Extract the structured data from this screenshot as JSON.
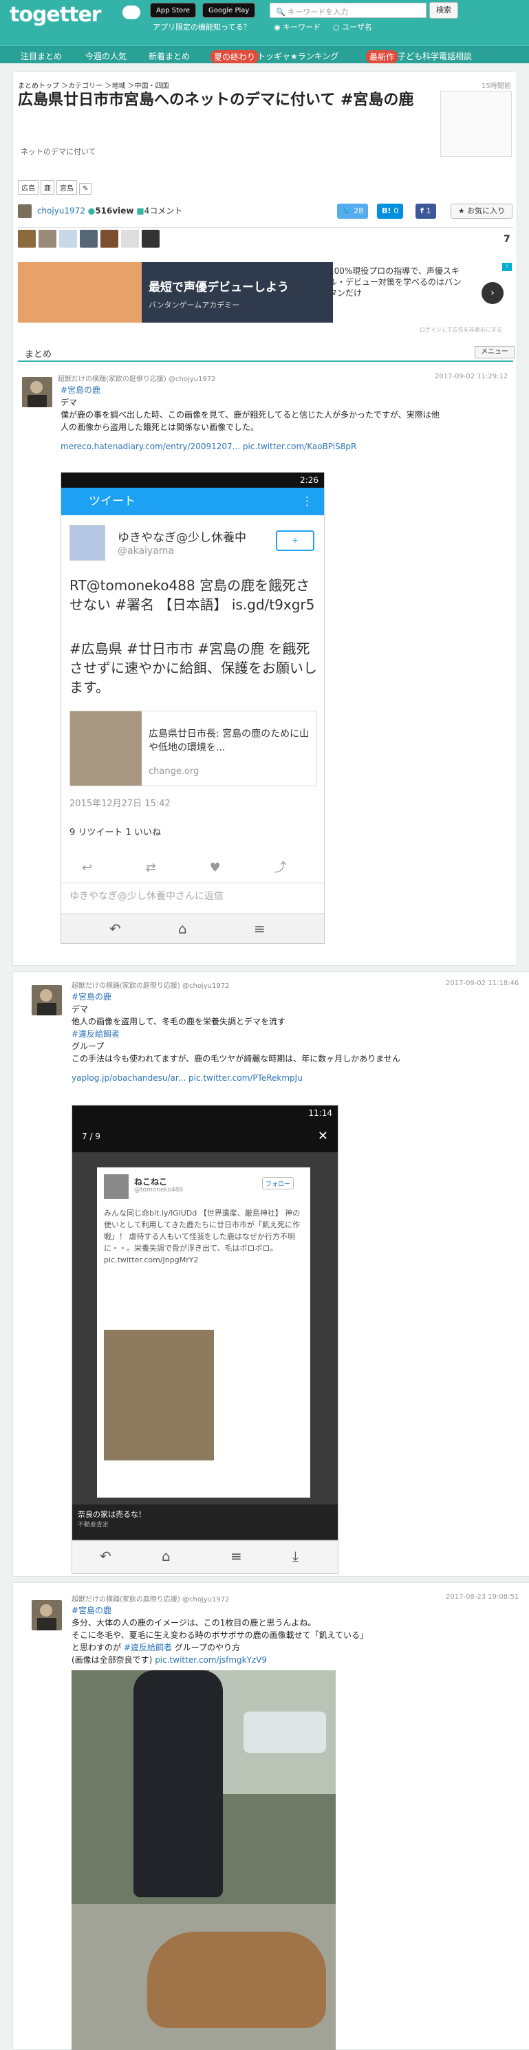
{
  "header": {
    "logo": "togetter",
    "appstore": "App Store",
    "googleplay": "Google Play",
    "tagline": "アプリ限定の機能知ってる？",
    "search_placeholder": "キーワードを入力",
    "search_button": "検索",
    "radio_keyword": "キーワード",
    "radio_user": "ユーザ名"
  },
  "nav": {
    "items": [
      "注目まとめ",
      "今週の人気",
      "新着まとめ"
    ],
    "badge1": "夏の終わり",
    "item4": "トッギャ★ランキング",
    "badge2": "最新作",
    "item5": "子ども科学電話相談"
  },
  "article": {
    "breadcrumb": "まとめトップ ＞カテゴリー ＞地域 ＞中国・四国",
    "timestamp": "15時間前",
    "title": "広島県廿日市市宮島へのネットのデマに付いて #宮島の鹿",
    "description": "ネットのデマに付いて",
    "tags": [
      "広島",
      "鹿",
      "宮島"
    ],
    "author": "chojyu1972",
    "views": "516view",
    "comments": "4コメント",
    "tweet_count": "28",
    "hatena_count": "0",
    "fb_count": "1",
    "fav_label": "お気に入り",
    "fav_count": "7"
  },
  "ad": {
    "headline": "最短で声優デビューしよう",
    "sub": "バンタンゲームアカデミー",
    "text": "100%現役プロの指導で、声優スキル・デビュー対策を学べるのはバンタンだけ",
    "note": "ログインして広告を非表示にする"
  },
  "section": {
    "matome": "まとめ",
    "menu": "メニュー"
  },
  "tweets": [
    {
      "name": "超獣だけの横踊(家飲の庭僚り応援) @chojyu1972",
      "date": "2017-09-02 11:29:12",
      "hashtag": "#宮島の鹿",
      "lines": [
        "デマ",
        "僕が鹿の事を調べ出した時、この画像を見て、鹿が餓死してると信じた人が多かったですが、実際は他",
        "人の画像から盗用した餓死とは関係ない画像でした。"
      ],
      "links": "mereco.hatenadiary.com/entry/20091207... pic.twitter.com/KaoBPiS8pR",
      "phone": {
        "time": "2:26",
        "bar_title": "ツイート",
        "user": "ゆきやなぎ@少し休養中",
        "handle": "@akaiyama",
        "text1": "RT@tomoneko488 宮島の鹿を餓死させない #署名 【日本語】 is.gd/t9xgr5",
        "text2": "#広島県 #廿日市市 #宮島の鹿 を餓死させずに速やかに給餌、保護をお願いします。",
        "card_title": "広島県廿日市長: 宮島の鹿のために山や低地の環境を...",
        "card_site": "change.org",
        "date": "2015年12月27日 15:42",
        "retweets": "9 リツイート  1 いいね",
        "reply": "ゆきやなぎ@少し休養中さんに返信"
      }
    },
    {
      "name": "超獣だけの横踊(家飲の庭僚り応援) @chojyu1972",
      "date": "2017-09-02 11:18:46",
      "hashtag": "#宮島の鹿",
      "lines": [
        "デマ",
        "他人の画像を盗用して、冬毛の鹿を栄養失調とデマを流す"
      ],
      "hashtag2": "#違反給餌者",
      "lines2": [
        "グループ",
        "この手法は今も使われてますが、鹿の毛ツヤが綺麗な時期は、年に数ヶ月しかありません"
      ],
      "links": "yaplog.jp/obachandesu/ar... pic.twitter.com/PTeRekmpJu",
      "phone": {
        "time": "11:14",
        "pager": "7 / 9",
        "user": "ねこねこ",
        "handle": "@tomoneko488",
        "follow": "フォロー",
        "text": "みんな同じ命bit.ly/lGlUDd 【世界遺産、厳島神社】 神の使いとして利用してきた鹿たちに廿日市市が「飢え死に作戦」！ 虐待する人もいて怪我をした鹿はなぜか行方不明に・・。栄養失調で骨が浮き出て、毛はボロボロ。 pic.twitter.com/JnpgMrY2",
        "ad_title": "奈良の家は売るな！",
        "ad_sub": "不動産査定"
      }
    },
    {
      "name": "超獣だけの横踊(家飲の庭僚り応援) @chojyu1972",
      "date": "2017-08-23 19:08:51",
      "hashtag": "#宮島の鹿",
      "lines": [
        "多分、大体の人の鹿のイメージは、この1枚目の鹿と思うんよね。",
        "そこに冬毛や、夏毛に生え変わる時のボサボサの鹿の画像載せて「飢えている」"
      ],
      "line3a": "と思わすのが ",
      "hashtag2": "#違反給餌者",
      "line3b": " グループのやり方",
      "line4": "(画像は全部奈良です) ",
      "link4": "pic.twitter.com/jsfmgkYzV9"
    }
  ]
}
